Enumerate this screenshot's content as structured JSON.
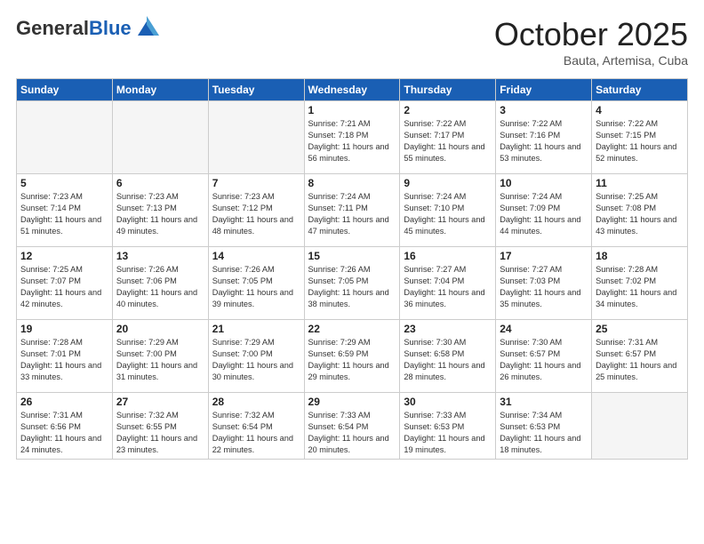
{
  "header": {
    "logo_general": "General",
    "logo_blue": "Blue",
    "month_title": "October 2025",
    "location": "Bauta, Artemisa, Cuba"
  },
  "days_of_week": [
    "Sunday",
    "Monday",
    "Tuesday",
    "Wednesday",
    "Thursday",
    "Friday",
    "Saturday"
  ],
  "weeks": [
    [
      {
        "day": "",
        "info": ""
      },
      {
        "day": "",
        "info": ""
      },
      {
        "day": "",
        "info": ""
      },
      {
        "day": "1",
        "info": "Sunrise: 7:21 AM\nSunset: 7:18 PM\nDaylight: 11 hours and 56 minutes."
      },
      {
        "day": "2",
        "info": "Sunrise: 7:22 AM\nSunset: 7:17 PM\nDaylight: 11 hours and 55 minutes."
      },
      {
        "day": "3",
        "info": "Sunrise: 7:22 AM\nSunset: 7:16 PM\nDaylight: 11 hours and 53 minutes."
      },
      {
        "day": "4",
        "info": "Sunrise: 7:22 AM\nSunset: 7:15 PM\nDaylight: 11 hours and 52 minutes."
      }
    ],
    [
      {
        "day": "5",
        "info": "Sunrise: 7:23 AM\nSunset: 7:14 PM\nDaylight: 11 hours and 51 minutes."
      },
      {
        "day": "6",
        "info": "Sunrise: 7:23 AM\nSunset: 7:13 PM\nDaylight: 11 hours and 49 minutes."
      },
      {
        "day": "7",
        "info": "Sunrise: 7:23 AM\nSunset: 7:12 PM\nDaylight: 11 hours and 48 minutes."
      },
      {
        "day": "8",
        "info": "Sunrise: 7:24 AM\nSunset: 7:11 PM\nDaylight: 11 hours and 47 minutes."
      },
      {
        "day": "9",
        "info": "Sunrise: 7:24 AM\nSunset: 7:10 PM\nDaylight: 11 hours and 45 minutes."
      },
      {
        "day": "10",
        "info": "Sunrise: 7:24 AM\nSunset: 7:09 PM\nDaylight: 11 hours and 44 minutes."
      },
      {
        "day": "11",
        "info": "Sunrise: 7:25 AM\nSunset: 7:08 PM\nDaylight: 11 hours and 43 minutes."
      }
    ],
    [
      {
        "day": "12",
        "info": "Sunrise: 7:25 AM\nSunset: 7:07 PM\nDaylight: 11 hours and 42 minutes."
      },
      {
        "day": "13",
        "info": "Sunrise: 7:26 AM\nSunset: 7:06 PM\nDaylight: 11 hours and 40 minutes."
      },
      {
        "day": "14",
        "info": "Sunrise: 7:26 AM\nSunset: 7:05 PM\nDaylight: 11 hours and 39 minutes."
      },
      {
        "day": "15",
        "info": "Sunrise: 7:26 AM\nSunset: 7:05 PM\nDaylight: 11 hours and 38 minutes."
      },
      {
        "day": "16",
        "info": "Sunrise: 7:27 AM\nSunset: 7:04 PM\nDaylight: 11 hours and 36 minutes."
      },
      {
        "day": "17",
        "info": "Sunrise: 7:27 AM\nSunset: 7:03 PM\nDaylight: 11 hours and 35 minutes."
      },
      {
        "day": "18",
        "info": "Sunrise: 7:28 AM\nSunset: 7:02 PM\nDaylight: 11 hours and 34 minutes."
      }
    ],
    [
      {
        "day": "19",
        "info": "Sunrise: 7:28 AM\nSunset: 7:01 PM\nDaylight: 11 hours and 33 minutes."
      },
      {
        "day": "20",
        "info": "Sunrise: 7:29 AM\nSunset: 7:00 PM\nDaylight: 11 hours and 31 minutes."
      },
      {
        "day": "21",
        "info": "Sunrise: 7:29 AM\nSunset: 7:00 PM\nDaylight: 11 hours and 30 minutes."
      },
      {
        "day": "22",
        "info": "Sunrise: 7:29 AM\nSunset: 6:59 PM\nDaylight: 11 hours and 29 minutes."
      },
      {
        "day": "23",
        "info": "Sunrise: 7:30 AM\nSunset: 6:58 PM\nDaylight: 11 hours and 28 minutes."
      },
      {
        "day": "24",
        "info": "Sunrise: 7:30 AM\nSunset: 6:57 PM\nDaylight: 11 hours and 26 minutes."
      },
      {
        "day": "25",
        "info": "Sunrise: 7:31 AM\nSunset: 6:57 PM\nDaylight: 11 hours and 25 minutes."
      }
    ],
    [
      {
        "day": "26",
        "info": "Sunrise: 7:31 AM\nSunset: 6:56 PM\nDaylight: 11 hours and 24 minutes."
      },
      {
        "day": "27",
        "info": "Sunrise: 7:32 AM\nSunset: 6:55 PM\nDaylight: 11 hours and 23 minutes."
      },
      {
        "day": "28",
        "info": "Sunrise: 7:32 AM\nSunset: 6:54 PM\nDaylight: 11 hours and 22 minutes."
      },
      {
        "day": "29",
        "info": "Sunrise: 7:33 AM\nSunset: 6:54 PM\nDaylight: 11 hours and 20 minutes."
      },
      {
        "day": "30",
        "info": "Sunrise: 7:33 AM\nSunset: 6:53 PM\nDaylight: 11 hours and 19 minutes."
      },
      {
        "day": "31",
        "info": "Sunrise: 7:34 AM\nSunset: 6:53 PM\nDaylight: 11 hours and 18 minutes."
      },
      {
        "day": "",
        "info": ""
      }
    ]
  ]
}
